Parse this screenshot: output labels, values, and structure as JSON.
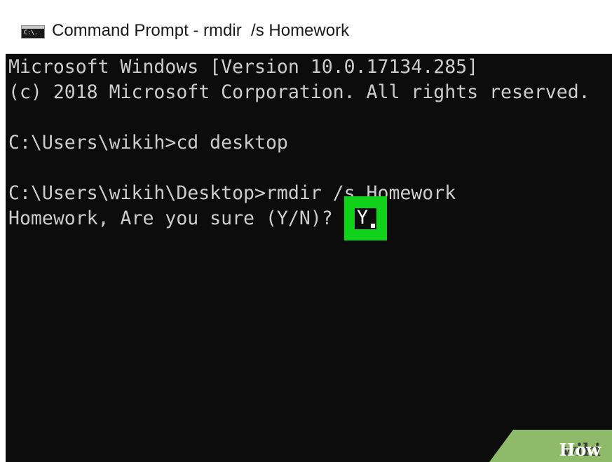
{
  "window": {
    "title": "Command Prompt - rmdir  /s Homework",
    "icon_name": "command-prompt-icon",
    "icon_text": "C:\\."
  },
  "console": {
    "lines": [
      "Microsoft Windows [Version 10.0.17134.285]",
      "(c) 2018 Microsoft Corporation. All rights reserved.",
      "",
      "C:\\Users\\wikih>cd desktop",
      "",
      "C:\\Users\\wikih\\Desktop>rmdir /s Homework",
      "Homework, Are you sure (Y/N)? "
    ],
    "answer": "Y"
  },
  "highlight": {
    "color": "#10d21a"
  },
  "watermark": {
    "prefix": "wiki",
    "suffix": "How"
  }
}
